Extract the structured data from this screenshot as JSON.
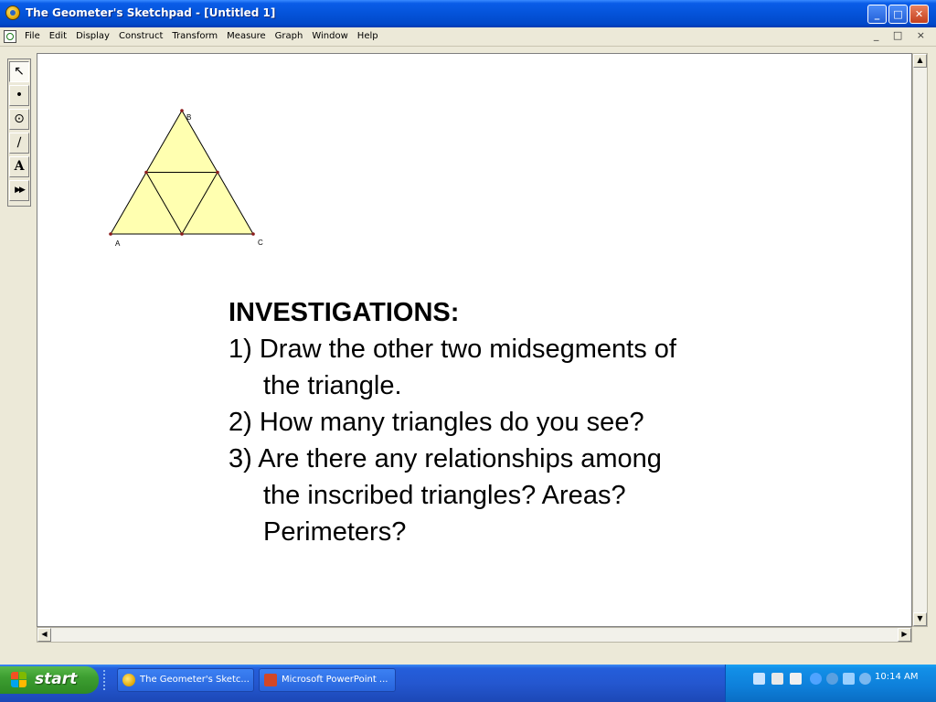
{
  "window": {
    "title": "The Geometer's Sketchpad - [Untitled 1]",
    "minimize_label": "_",
    "maximize_label": "□",
    "close_label": "✕"
  },
  "menu": {
    "items": [
      "File",
      "Edit",
      "Display",
      "Construct",
      "Transform",
      "Measure",
      "Graph",
      "Window",
      "Help"
    ],
    "mdi_controls": "_ □ ×"
  },
  "toolbox": {
    "tools": [
      {
        "name": "arrow-tool",
        "glyph": "↖"
      },
      {
        "name": "point-tool",
        "glyph": "•"
      },
      {
        "name": "compass-tool",
        "glyph": "⊙"
      },
      {
        "name": "straightedge-tool",
        "glyph": "∕"
      },
      {
        "name": "text-tool",
        "glyph": "A"
      },
      {
        "name": "custom-tool",
        "glyph": "▶▶"
      }
    ]
  },
  "sketch": {
    "point_labels": {
      "a": "A",
      "b": "B",
      "c": "C"
    },
    "fill_color": "#ffffb0",
    "point_color": "#8b1a1a"
  },
  "investigations": {
    "heading": "INVESTIGATIONS:",
    "items": [
      {
        "line1": "1) Draw the other two midsegments of",
        "line2": "the triangle."
      },
      {
        "line1": "2) How many triangles do you see?"
      },
      {
        "line1": "3) Are there any relationships among",
        "line2": "the inscribed triangles?  Areas?",
        "line3": "Perimeters?"
      }
    ]
  },
  "taskbar": {
    "start_label": "start",
    "tasks": [
      {
        "label": "The Geometer's Sketc...",
        "icon": "sketchpad-icon"
      },
      {
        "label": "Microsoft PowerPoint ...",
        "icon": "powerpoint-icon"
      }
    ],
    "clock": "10:14 AM"
  }
}
